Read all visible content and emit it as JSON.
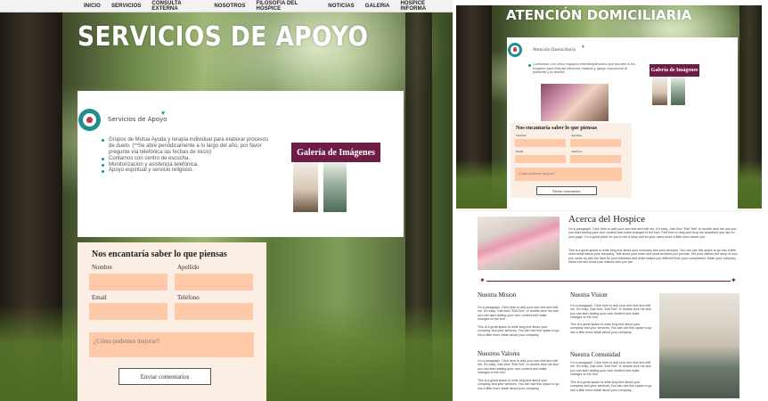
{
  "nav": [
    "INICIO",
    "SERVICIOS",
    "CONSULTA EXTERNA",
    "NOSOTROS",
    "FILOSOFIA DEL HOSPICE",
    "NOTICIAS",
    "GALERIA",
    "HOSPICE INFORMA"
  ],
  "panel1": {
    "title": "SERVICIOS DE APOYO",
    "section_label": "Servicios de Apoyo",
    "services": [
      "Grupos de Mutua Ayuda y terapia individual para elaborar procesos de duelo. (**Se abre periódicamente a lo largo del año, por favor pregunte vía telefónica las fechas de inicio)",
      "Contamos con centro de escucha.",
      "Monitorización y asistencia telefónica.",
      "Apoyo espiritual y servicio religioso."
    ],
    "gallery_button": "Galería de Imágenes",
    "form": {
      "title": "Nos encantaría saber lo que piensas",
      "name_label": "Nombre",
      "surname_label": "Apellido",
      "email_label": "Email",
      "phone_label": "Teléfono",
      "message_placeholder": "¿Cómo podemos mejorar?",
      "submit": "Enviar comentarios"
    }
  },
  "panel2": {
    "title": "ATENCIÓN DOMICILIARIA",
    "section_label": "Atención Domiciliaria",
    "bullet": "Contamos con cinco equipos interdisciplinarios que acuden a los hogares para brindar atención médica y apoyo emocional al paciente y la familia.",
    "gallery_button": "Galería de Imágenes",
    "form": {
      "title": "Nos encantaría saber lo que piensas",
      "name_label": "Nombre",
      "surname_label": "Apellido",
      "email_label": "Email",
      "phone_label": "Teléfono",
      "message_placeholder": "¿Cómo podemos mejorar?",
      "submit": "Enviar comentarios"
    }
  },
  "panel3": {
    "about_title": "Acerca del Hospice",
    "about_p1": "I'm a paragraph. Click here to add your own text and edit me. It's easy. Just click \"Edit Text\" or double click me and you can start adding your own content and make changes to the font. Feel free to drag and drop me anywhere you like on your page. I'm a great place for you to tell a story and let your users know a little more about you.",
    "about_p2": "This is a great space to write long text about your company and your services. You can use this space to go into a little more detail about your company. Talk about your team and what services you provide. Tell your visitors the story of how you came up with the idea for your business and what makes you different from your competitors. Make your company stand out and show your visitors who you are.",
    "mision_title": "Nuestra Mision",
    "vision_title": "Nuestra Vision",
    "valores_title": "Nuestros Valores",
    "comunidad_title": "Nuestra Comunidad",
    "para_a": "I'm a paragraph. Click here to add your own text and edit me. It's easy. Just click \"Edit Text\" or double click me and you can start adding your own content and make changes to the font.",
    "para_b": "This is a great space to write long text about your company and your services. You can use this space to go into a little more detail about your company."
  },
  "colors": {
    "accent": "#6e1e46",
    "teal": "#1e8e8e",
    "input_fill": "#fdc9a8",
    "form_bg": "#fbeee5"
  }
}
